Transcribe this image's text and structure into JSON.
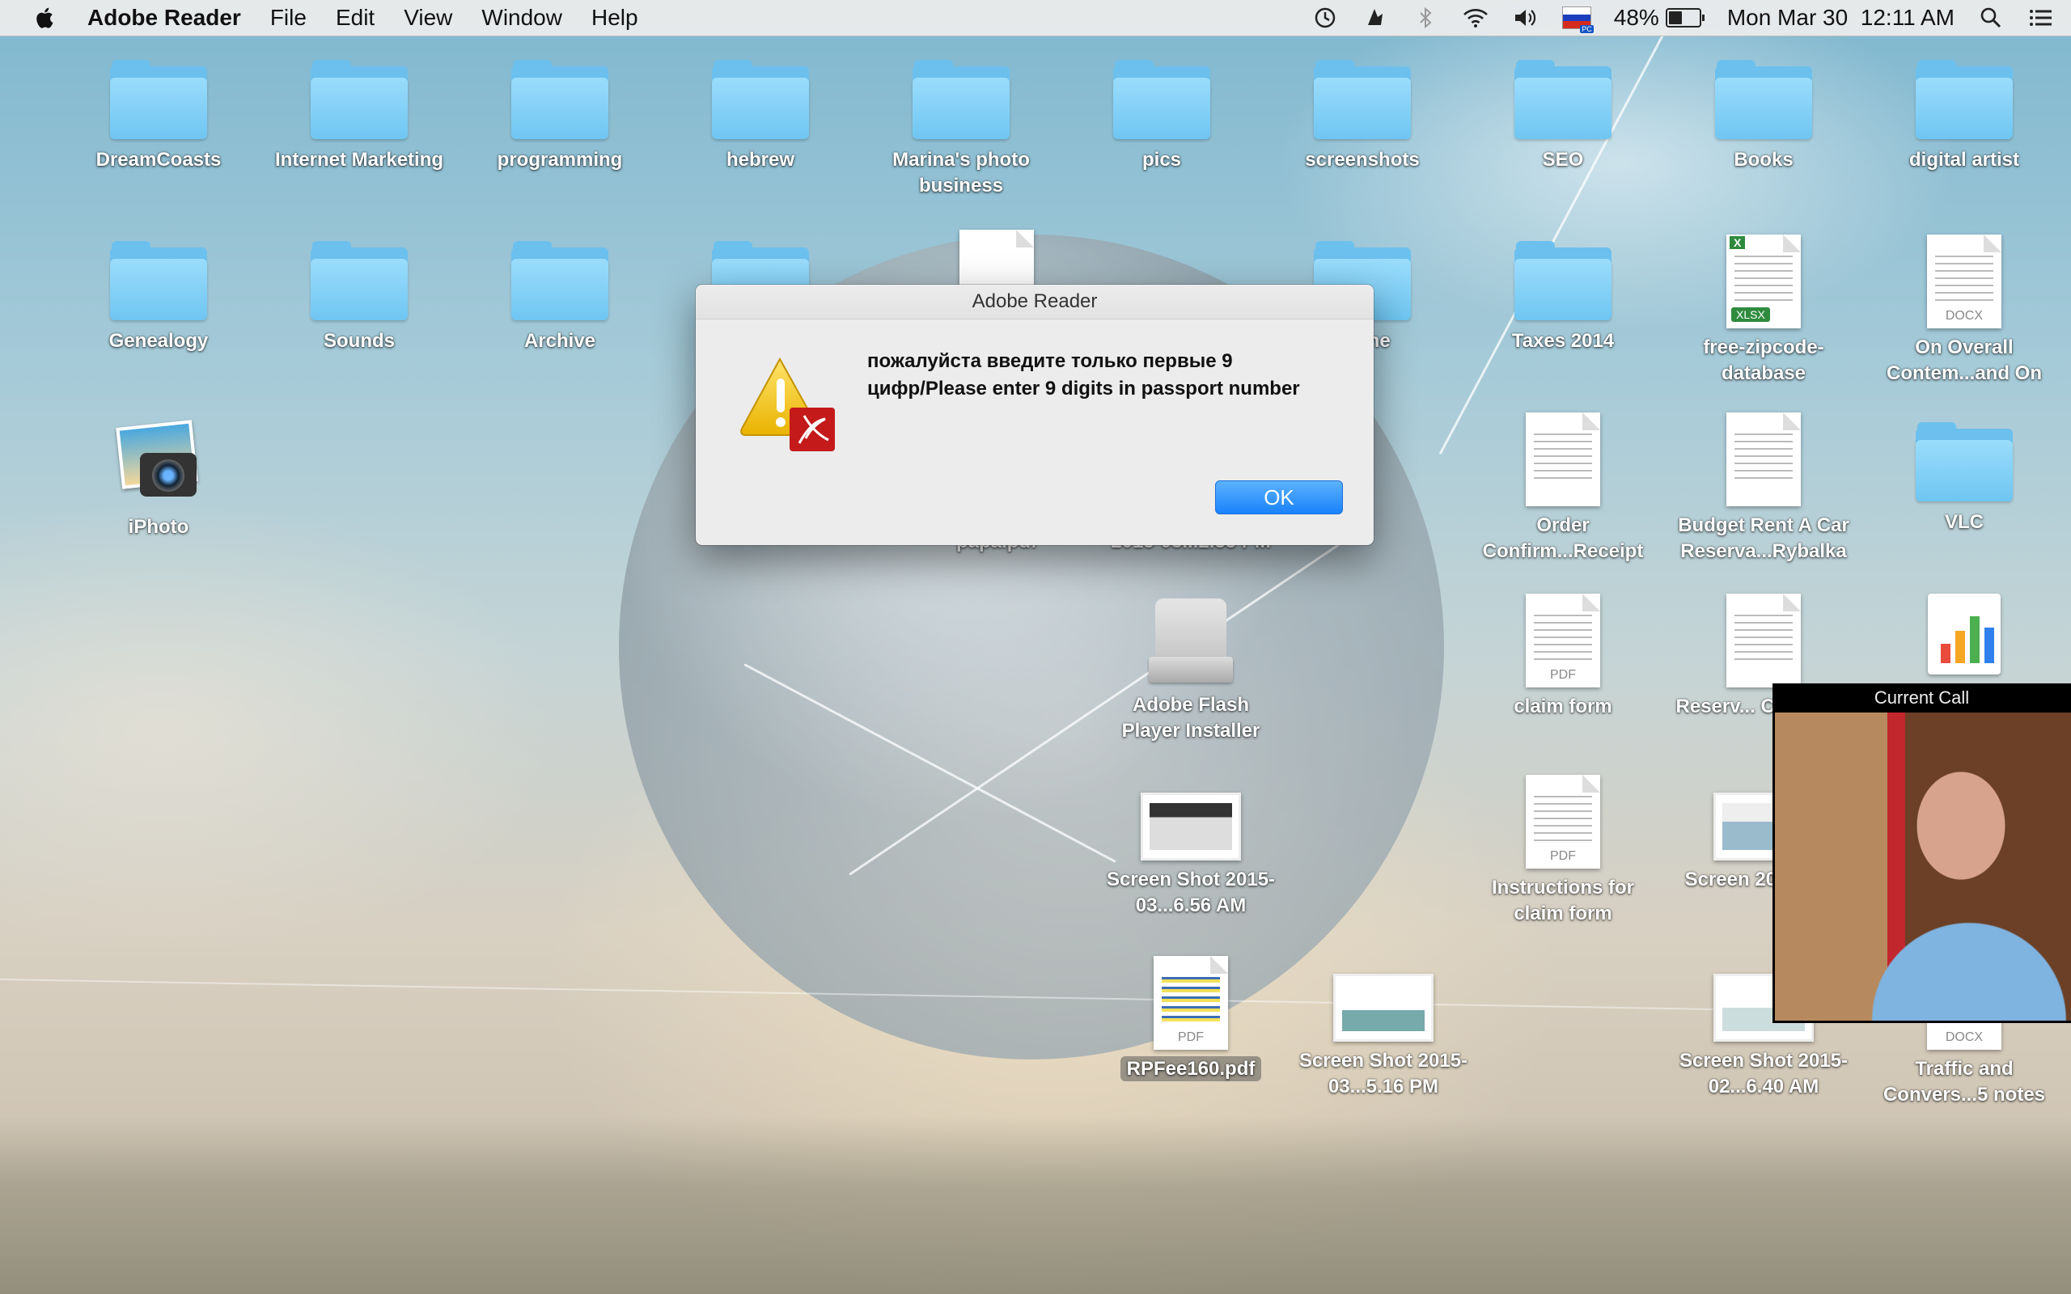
{
  "menubar": {
    "app_name": "Adobe Reader",
    "items": [
      "File",
      "Edit",
      "View",
      "Window",
      "Help"
    ],
    "battery_percent": "48%",
    "battery_level": 0.48,
    "clock": "Mon Mar 30  12:11 AM"
  },
  "desktop": {
    "row1": [
      "DreamCoasts",
      "Internet Marketing",
      "programming",
      "hebrew",
      "Marina's photo business",
      "pics",
      "screenshots",
      "SEO",
      "Books",
      "digital artist"
    ],
    "row2_left": [
      "Genealogy",
      "Sounds",
      "Archive"
    ],
    "stone_partial": "tone",
    "taxes": "Taxes 2014",
    "zipcode": "free-zipcode-database",
    "zipcode_tag": "XLSX",
    "overall": "On Overall Contem...and On",
    "overall_tag": "DOCX",
    "iphoto": "iPhoto",
    "papa": "papa.pdf",
    "shot_235": "2015-03...2.35 PM",
    "order": "Order Confirm...Receipt",
    "budget": "Budget Rent A Car Reserva...Rybalka",
    "vlc": "VLC",
    "flash": "Adobe Flash Player Installer",
    "claim": "claim form",
    "claim_tag": "PDF",
    "reserv": "Reserv... Confirm...",
    "shot_656": "Screen Shot 2015-03...6.56 AM",
    "instructions": "Instructions for claim form",
    "instructions_tag": "PDF",
    "shot_jan": "Screen 2015-01...",
    "rpfee": "RPFee160.pdf",
    "rpfee_tag": "PDF",
    "shot_516": "Screen Shot 2015-03...5.16 PM",
    "shot_640": "Screen Shot 2015-02...6.40 AM",
    "traffic": "Traffic and Convers...5 notes",
    "traffic_tag": "DOCX"
  },
  "dialog": {
    "title": "Adobe Reader",
    "message": "пожалуйста введите только первые 9 цифр/Please enter 9 digits in passport number",
    "ok_label": "OK"
  },
  "call_window": {
    "title": "Current Call"
  },
  "colors": {
    "folder": "#6cc0ee",
    "ok_button": "#1a82fb",
    "menubar": "#ececec"
  }
}
